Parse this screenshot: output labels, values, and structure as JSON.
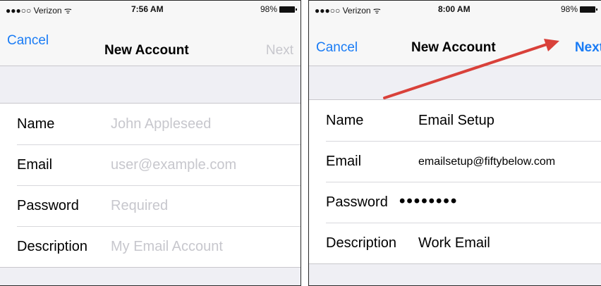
{
  "left": {
    "status": {
      "carrier": "●●●○○ Verizon ᯤ",
      "time": "7:56 AM",
      "battery": "98%"
    },
    "nav": {
      "cancel": "Cancel",
      "title": "New Account",
      "next": "Next",
      "next_enabled": false
    },
    "fields": [
      {
        "label": "Name",
        "placeholder": "John Appleseed"
      },
      {
        "label": "Email",
        "placeholder": "user@example.com"
      },
      {
        "label": "Password",
        "placeholder": "Required"
      },
      {
        "label": "Description",
        "placeholder": "My Email Account"
      }
    ]
  },
  "right": {
    "status": {
      "carrier": "●●●○○ Verizon ᯤ",
      "time": "8:00 AM",
      "battery": "98%"
    },
    "nav": {
      "cancel": "Cancel",
      "title": "New Account",
      "next": "Next",
      "next_enabled": true
    },
    "fields": [
      {
        "label": "Name",
        "value": "Email Setup"
      },
      {
        "label": "Email",
        "value": "emailsetup@fiftybelow.com"
      },
      {
        "label": "Password",
        "value": "••••••••"
      },
      {
        "label": "Description",
        "value": "Work Email"
      }
    ],
    "annotation": {
      "type": "arrow",
      "color": "#d9413a",
      "points_to": "next-button"
    }
  },
  "colors": {
    "accent": "#1a7cf5",
    "disabled": "#c7c7cd",
    "placeholder": "#c7c7cd",
    "arrow": "#d9413a"
  }
}
